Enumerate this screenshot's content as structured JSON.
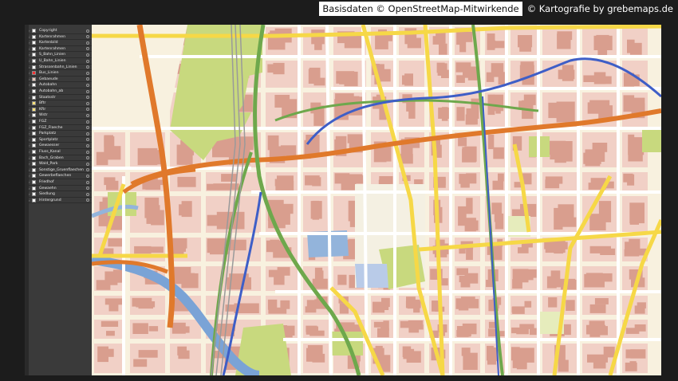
{
  "credits": {
    "osm": "Basisdaten © OpenStreetMap-Mitwirkende",
    "grebe": "© Kartografie by grebemaps.de"
  },
  "layers_panel": {
    "layers": [
      {
        "label": "Copyright",
        "color": "#ffffff"
      },
      {
        "label": "Kartenrahmen",
        "color": "#ffffff"
      },
      {
        "label": "Kartenbild",
        "color": "#ffffff"
      },
      {
        "label": "Kartenrahmen",
        "color": "#ffffff"
      },
      {
        "label": "S_Bahn_Linien",
        "color": "#ffffff"
      },
      {
        "label": "U_Bahn_Linien",
        "color": "#ffffff"
      },
      {
        "label": "Strassenbahn_Linien",
        "color": "#ffffff"
      },
      {
        "label": "Bus_Linien",
        "color": "#ff3333"
      },
      {
        "label": "Gebaeude",
        "color": "#e8c6b8"
      },
      {
        "label": "Autobahn",
        "color": "#ffffff"
      },
      {
        "label": "Autobahn_ab",
        "color": "#ffffff"
      },
      {
        "label": "Staatsstr",
        "color": "#ffffff"
      },
      {
        "label": "Bftr",
        "color": "#ffe27a"
      },
      {
        "label": "Kftr",
        "color": "#ffe27a"
      },
      {
        "label": "Wstr",
        "color": "#ffffff"
      },
      {
        "label": "FGZ",
        "color": "#ffffff"
      },
      {
        "label": "FGZ_Flaeche",
        "color": "#ffffff"
      },
      {
        "label": "Parkplatz",
        "color": "#ffffff"
      },
      {
        "label": "Sportplatz",
        "color": "#ffffff"
      },
      {
        "label": "Gewaesser",
        "color": "#ffffff"
      },
      {
        "label": "Fluss_Kanal",
        "color": "#ffffff"
      },
      {
        "label": "Bach_Graben",
        "color": "#ffffff"
      },
      {
        "label": "Wald_Park",
        "color": "#ffffff"
      },
      {
        "label": "Sonstige_Gruenflaechen",
        "color": "#ffffff"
      },
      {
        "label": "Gewerbeflaechen",
        "color": "#ffffff"
      },
      {
        "label": "Friedhof",
        "color": "#ffffff"
      },
      {
        "label": "Gewaehn",
        "color": "#ffffff"
      },
      {
        "label": "Siedlung",
        "color": "#ffffff"
      },
      {
        "label": "Hintergrund",
        "color": "#ffffff"
      }
    ]
  },
  "map_colors": {
    "background": "#f8f1df",
    "building": "#d99e8e",
    "block": "#f1d0c6",
    "park": "#c8d97e",
    "pale_green": "#e6ecbc",
    "water": "#93b4db",
    "motorway": "#e0792b",
    "main_road": "#f6d847",
    "tram": "#6ea84c",
    "subway": "#3e5ec7"
  }
}
